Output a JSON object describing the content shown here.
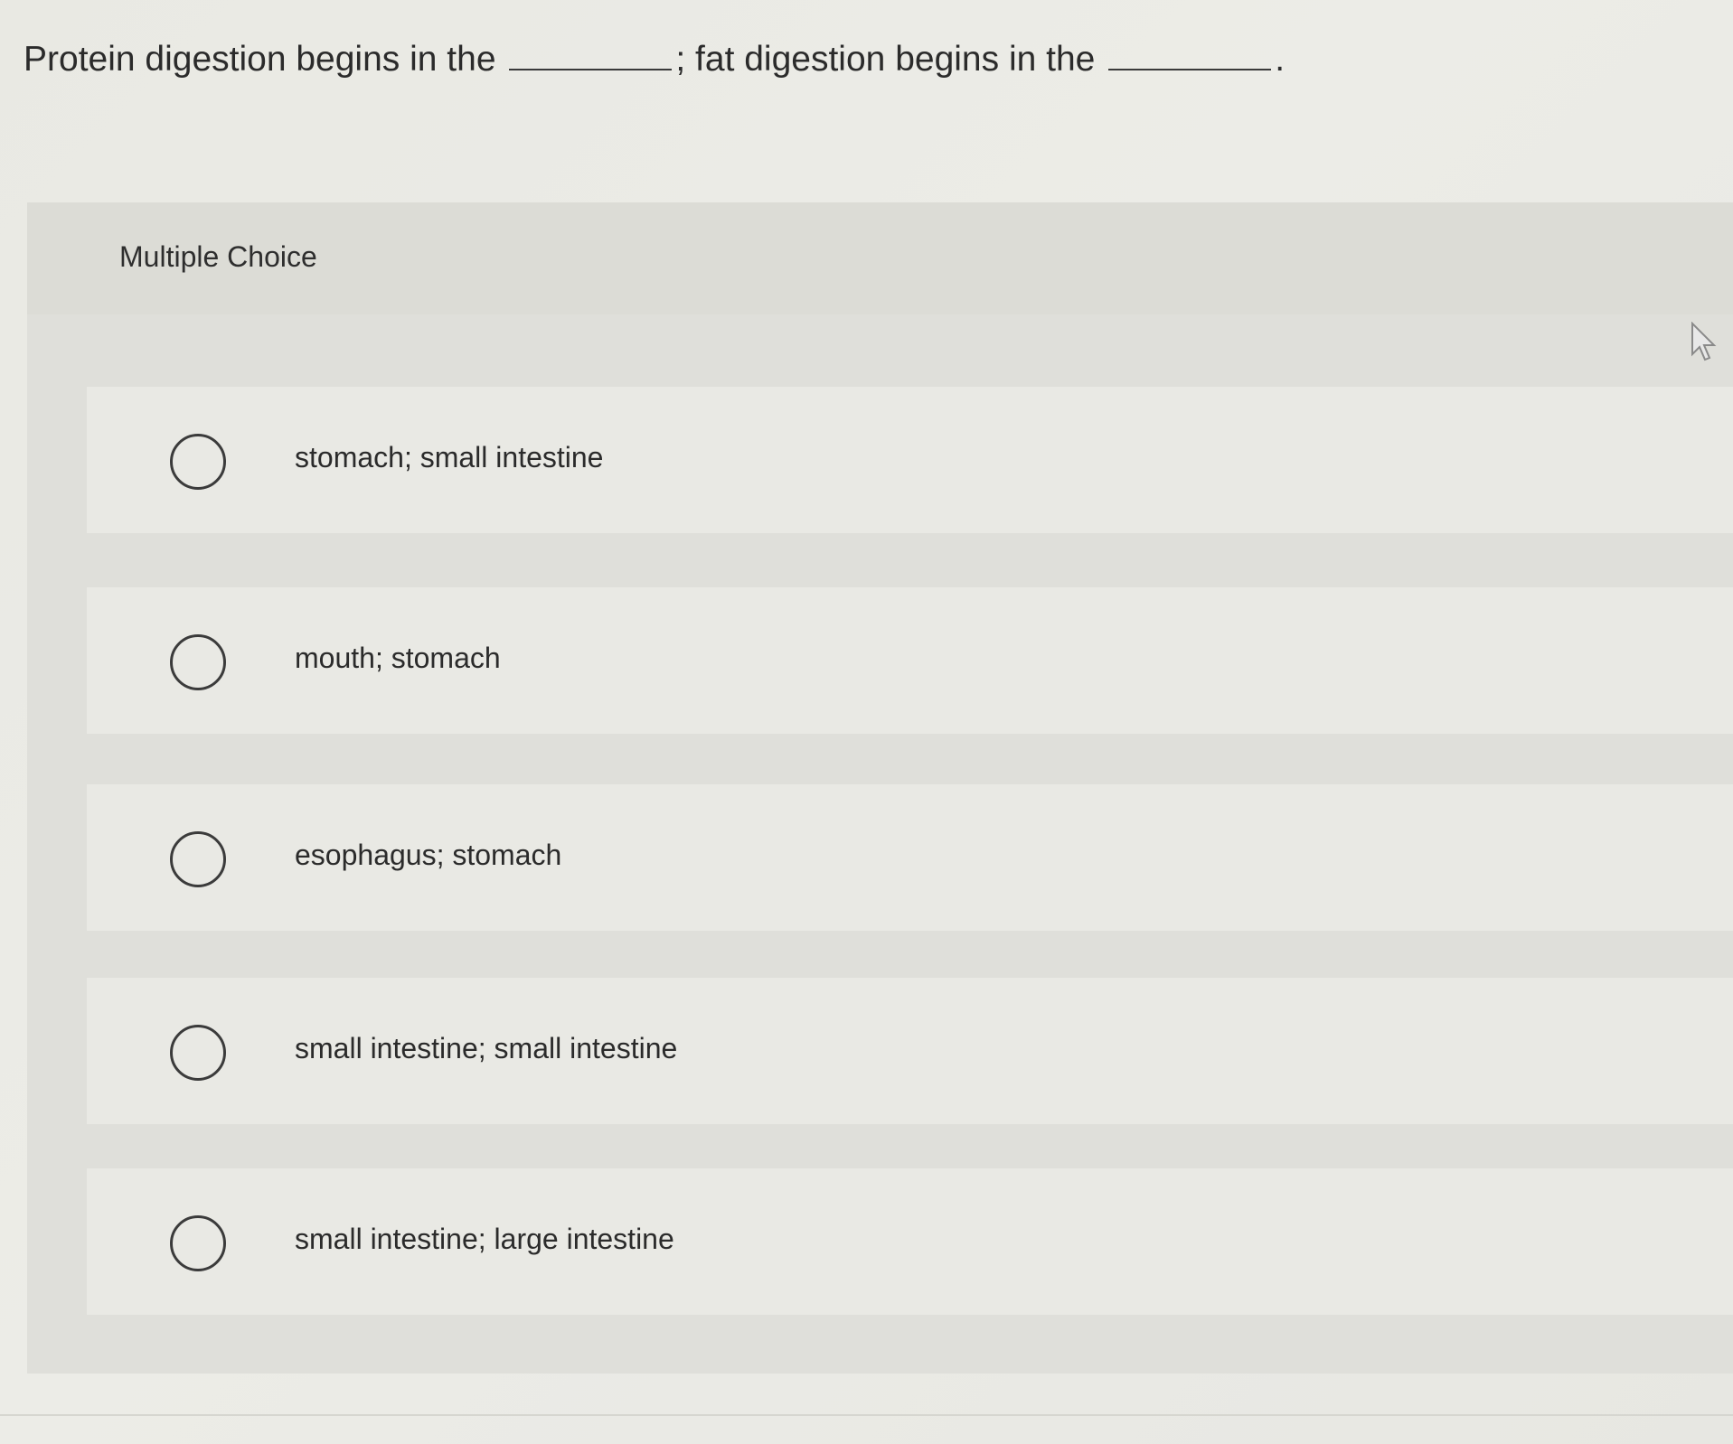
{
  "question": {
    "part1": "Protein digestion begins in the",
    "part2": "; fat digestion begins in the",
    "part3": "."
  },
  "panel": {
    "title": "Multiple Choice"
  },
  "options": [
    {
      "label": "stomach; small intestine"
    },
    {
      "label": "mouth; stomach"
    },
    {
      "label": "esophagus; stomach"
    },
    {
      "label": "small intestine; small intestine"
    },
    {
      "label": "small intestine; large intestine"
    }
  ],
  "colors": {
    "background": "#ebebe6",
    "panel": "#e0e0db",
    "option_card": "#e9e9e4",
    "text": "#2b2b2b"
  }
}
